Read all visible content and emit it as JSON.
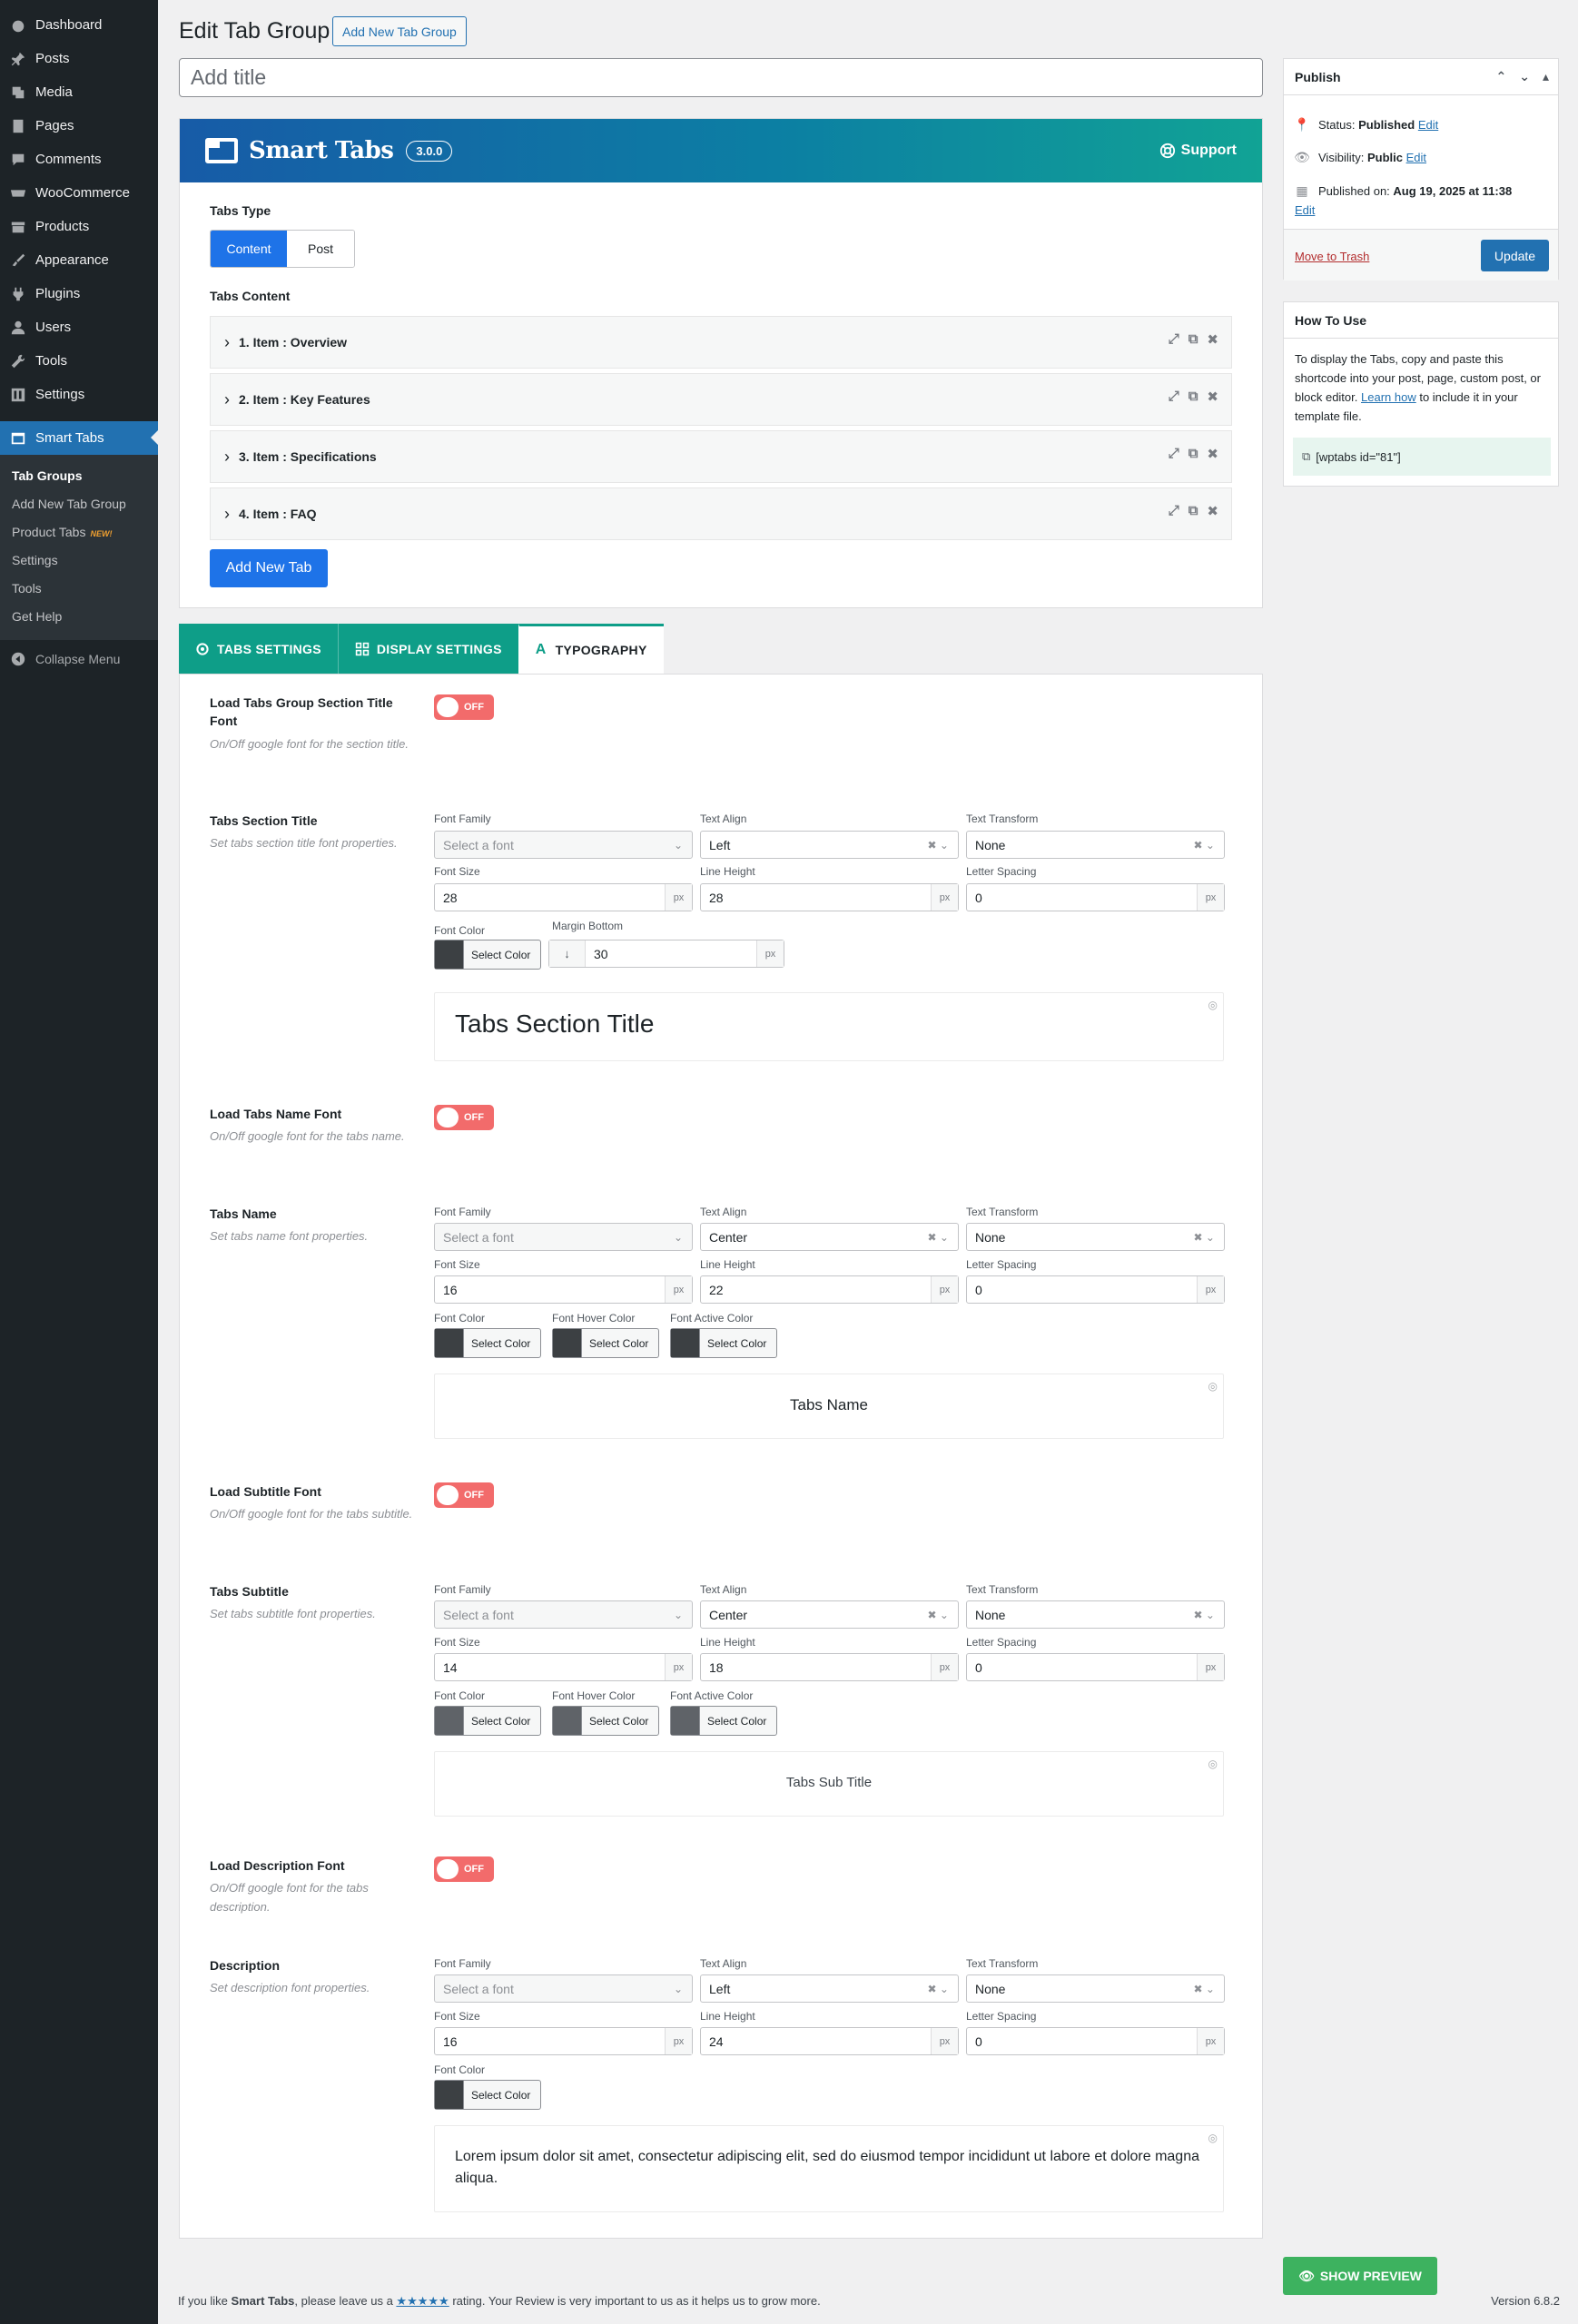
{
  "sidebar": {
    "items": [
      {
        "label": "Dashboard",
        "icon": "dashboard-icon"
      },
      {
        "label": "Posts",
        "icon": "pin-icon"
      },
      {
        "label": "Media",
        "icon": "media-icon"
      },
      {
        "label": "Pages",
        "icon": "pages-icon"
      },
      {
        "label": "Comments",
        "icon": "comment-icon"
      },
      {
        "label": "WooCommerce",
        "icon": "woocommerce-icon"
      },
      {
        "label": "Products",
        "icon": "archive-icon"
      },
      {
        "label": "Appearance",
        "icon": "paintbrush-icon"
      },
      {
        "label": "Plugins",
        "icon": "plugin-icon"
      },
      {
        "label": "Users",
        "icon": "users-icon"
      },
      {
        "label": "Tools",
        "icon": "wrench-icon"
      },
      {
        "label": "Settings",
        "icon": "settings-icon"
      }
    ],
    "active": {
      "label": "Smart Tabs",
      "icon": "smart-tabs-icon"
    },
    "submenu": [
      {
        "label": "Tab Groups",
        "current": true
      },
      {
        "label": "Add New Tab Group"
      },
      {
        "label": "Product Tabs",
        "badge": "NEW!"
      },
      {
        "label": "Settings"
      },
      {
        "label": "Tools"
      },
      {
        "label": "Get Help"
      }
    ],
    "collapse": "Collapse Menu"
  },
  "header": {
    "title": "Edit Tab Group",
    "add_new": "Add New Tab Group",
    "title_placeholder": "Add title"
  },
  "plugin": {
    "name": "Smart Tabs",
    "version": "3.0.0",
    "support": "Support",
    "tabs_type_label": "Tabs Type",
    "tabs_type_options": [
      "Content",
      "Post"
    ],
    "tabs_content_label": "Tabs Content",
    "tab_items": [
      "1. Item : Overview",
      "2. Item : Key Features",
      "3. Item : Specifications",
      "4. Item : FAQ"
    ],
    "add_tab": "Add New Tab"
  },
  "settings_tabs": [
    "TABS SETTINGS",
    "DISPLAY SETTINGS",
    "TYPOGRAPHY"
  ],
  "labels": {
    "font_family": "Font Family",
    "text_align": "Text Align",
    "text_transform": "Text Transform",
    "font_size": "Font Size",
    "line_height": "Line Height",
    "letter_spacing": "Letter Spacing",
    "font_color": "Font Color",
    "font_hover_color": "Font Hover Color",
    "font_active_color": "Font Active Color",
    "margin_bottom": "Margin Bottom",
    "select_font": "Select a font",
    "select_color": "Select Color",
    "unit": "px",
    "off": "OFF"
  },
  "typography": {
    "section_title_font": {
      "title": "Load Tabs Group Section Title Font",
      "desc": "On/Off google font for the section title."
    },
    "section_title": {
      "title": "Tabs Section Title",
      "desc": "Set tabs section title font properties.",
      "align": "Left",
      "transform": "None",
      "size": "28",
      "line_height": "28",
      "spacing": "0",
      "margin_bottom": "30",
      "preview": "Tabs Section Title"
    },
    "name_font": {
      "title": "Load Tabs Name Font",
      "desc": "On/Off google font for the tabs name."
    },
    "name": {
      "title": "Tabs Name",
      "desc": "Set tabs name font properties.",
      "align": "Center",
      "transform": "None",
      "size": "16",
      "line_height": "22",
      "spacing": "0",
      "preview": "Tabs Name"
    },
    "subtitle_font": {
      "title": "Load Subtitle Font",
      "desc": "On/Off google font for the tabs subtitle."
    },
    "subtitle": {
      "title": "Tabs Subtitle",
      "desc": "Set tabs subtitle font properties.",
      "align": "Center",
      "transform": "None",
      "size": "14",
      "line_height": "18",
      "spacing": "0",
      "preview": "Tabs Sub Title"
    },
    "desc_font": {
      "title": "Load Description Font",
      "desc": "On/Off google font for the tabs description."
    },
    "description": {
      "title": "Description",
      "desc": "Set description font properties.",
      "align": "Left",
      "transform": "None",
      "size": "16",
      "line_height": "24",
      "spacing": "0",
      "preview": "Lorem ipsum dolor sit amet, consectetur adipiscing elit, sed do eiusmod tempor incididunt ut labore et dolore magna aliqua."
    }
  },
  "publish": {
    "title": "Publish",
    "status_label": "Status:",
    "status_value": "Published",
    "visibility_label": "Visibility:",
    "visibility_value": "Public",
    "published_label": "Published on:",
    "published_value": "Aug 19, 2025 at 11:38",
    "edit": "Edit",
    "trash": "Move to Trash",
    "update": "Update"
  },
  "howto": {
    "title": "How To Use",
    "text_before": "To display the Tabs, copy and paste this shortcode into your post, page, custom post, or block editor.",
    "link": "Learn how",
    "text_after": "to include it in your template file.",
    "shortcode": "[wptabs id=\"81\"]"
  },
  "preview_button": "SHOW PREVIEW",
  "footer": {
    "prefix": "If you like",
    "brand": "Smart Tabs",
    "middle": ", please leave us a",
    "stars": "★★★★★",
    "suffix": "rating. Your Review is very important to us as it helps us to grow more.",
    "version": "Version 6.8.2"
  },
  "colors": {
    "accent": "#2271b1",
    "brand_teal": "#0e9e88",
    "toggle_off": "#f26b6b",
    "preview_btn": "#3db25f",
    "sidebar": "#1d2327"
  }
}
